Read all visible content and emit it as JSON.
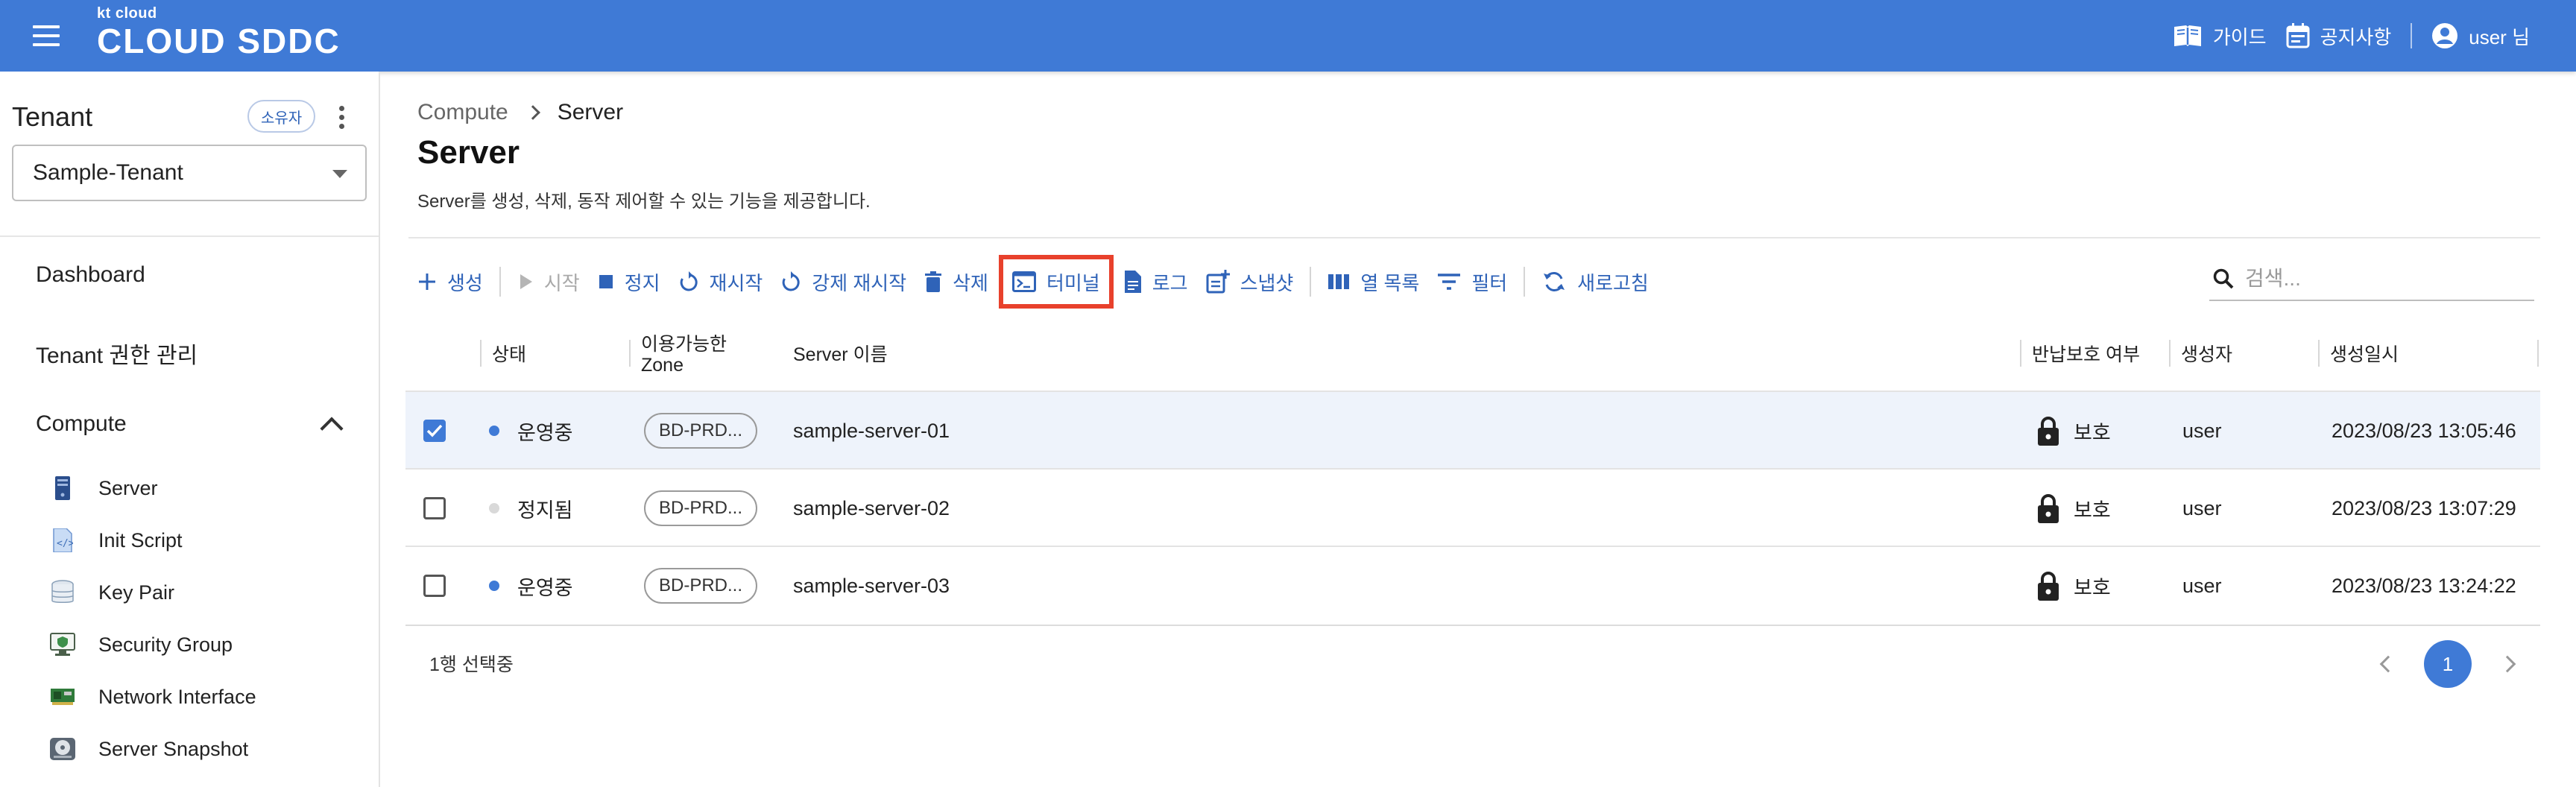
{
  "header": {
    "logo_small": "kt cloud",
    "logo_main": "CLOUD SDDC",
    "guide_label": "가이드",
    "notice_label": "공지사항",
    "user_label": "user 님",
    "bar_color": "#3f7ad6"
  },
  "sidebar": {
    "tenant_heading": "Tenant",
    "owner_badge": "소유자",
    "tenant_selected": "Sample-Tenant",
    "nav": [
      {
        "label": "Dashboard"
      },
      {
        "label": "Tenant 권한 관리"
      }
    ],
    "section": {
      "label": "Compute",
      "expanded": true
    },
    "sub_items": [
      {
        "label": "Server",
        "icon": "server-icon"
      },
      {
        "label": "Init Script",
        "icon": "script-icon"
      },
      {
        "label": "Key Pair",
        "icon": "database-icon"
      },
      {
        "label": "Security Group",
        "icon": "monitor-shield-icon"
      },
      {
        "label": "Network Interface",
        "icon": "network-card-icon"
      },
      {
        "label": "Server Snapshot",
        "icon": "disk-icon"
      }
    ]
  },
  "breadcrumb": {
    "parent": "Compute",
    "current": "Server"
  },
  "page": {
    "title": "Server",
    "description": "Server를 생성, 삭제, 동작 제어할 수 있는 기능을 제공합니다."
  },
  "toolbar": {
    "create": "생성",
    "start": "시작",
    "stop": "정지",
    "restart": "재시작",
    "force_restart": "강제 재시작",
    "delete": "삭제",
    "terminal": "터미널",
    "log": "로그",
    "snapshot": "스냅샷",
    "columns": "열 목록",
    "filter": "필터",
    "refresh": "새로고침",
    "highlight_color": "#e8412c"
  },
  "search": {
    "placeholder": "검색..."
  },
  "table": {
    "headers": {
      "status": "상태",
      "zone_line1": "이용가능한",
      "zone_line2": "Zone",
      "name": "Server 이름",
      "protection": "반납보호 여부",
      "creator": "생성자",
      "created": "생성일시"
    },
    "rows": [
      {
        "selected": true,
        "status": "운영중",
        "status_color": "#3f7ad6",
        "zone": "BD-PRD...",
        "name": "sample-server-01",
        "protection": "보호",
        "creator": "user",
        "created": "2023/08/23 13:05:46"
      },
      {
        "selected": false,
        "status": "정지됨",
        "status_color": "#d9d9d9",
        "zone": "BD-PRD...",
        "name": "sample-server-02",
        "protection": "보호",
        "creator": "user",
        "created": "2023/08/23 13:07:29"
      },
      {
        "selected": false,
        "status": "운영중",
        "status_color": "#3f7ad6",
        "zone": "BD-PRD...",
        "name": "sample-server-03",
        "protection": "보호",
        "creator": "user",
        "created": "2023/08/23 13:24:22"
      }
    ]
  },
  "footer": {
    "selection_text": "1행 선택중",
    "current_page": "1"
  }
}
